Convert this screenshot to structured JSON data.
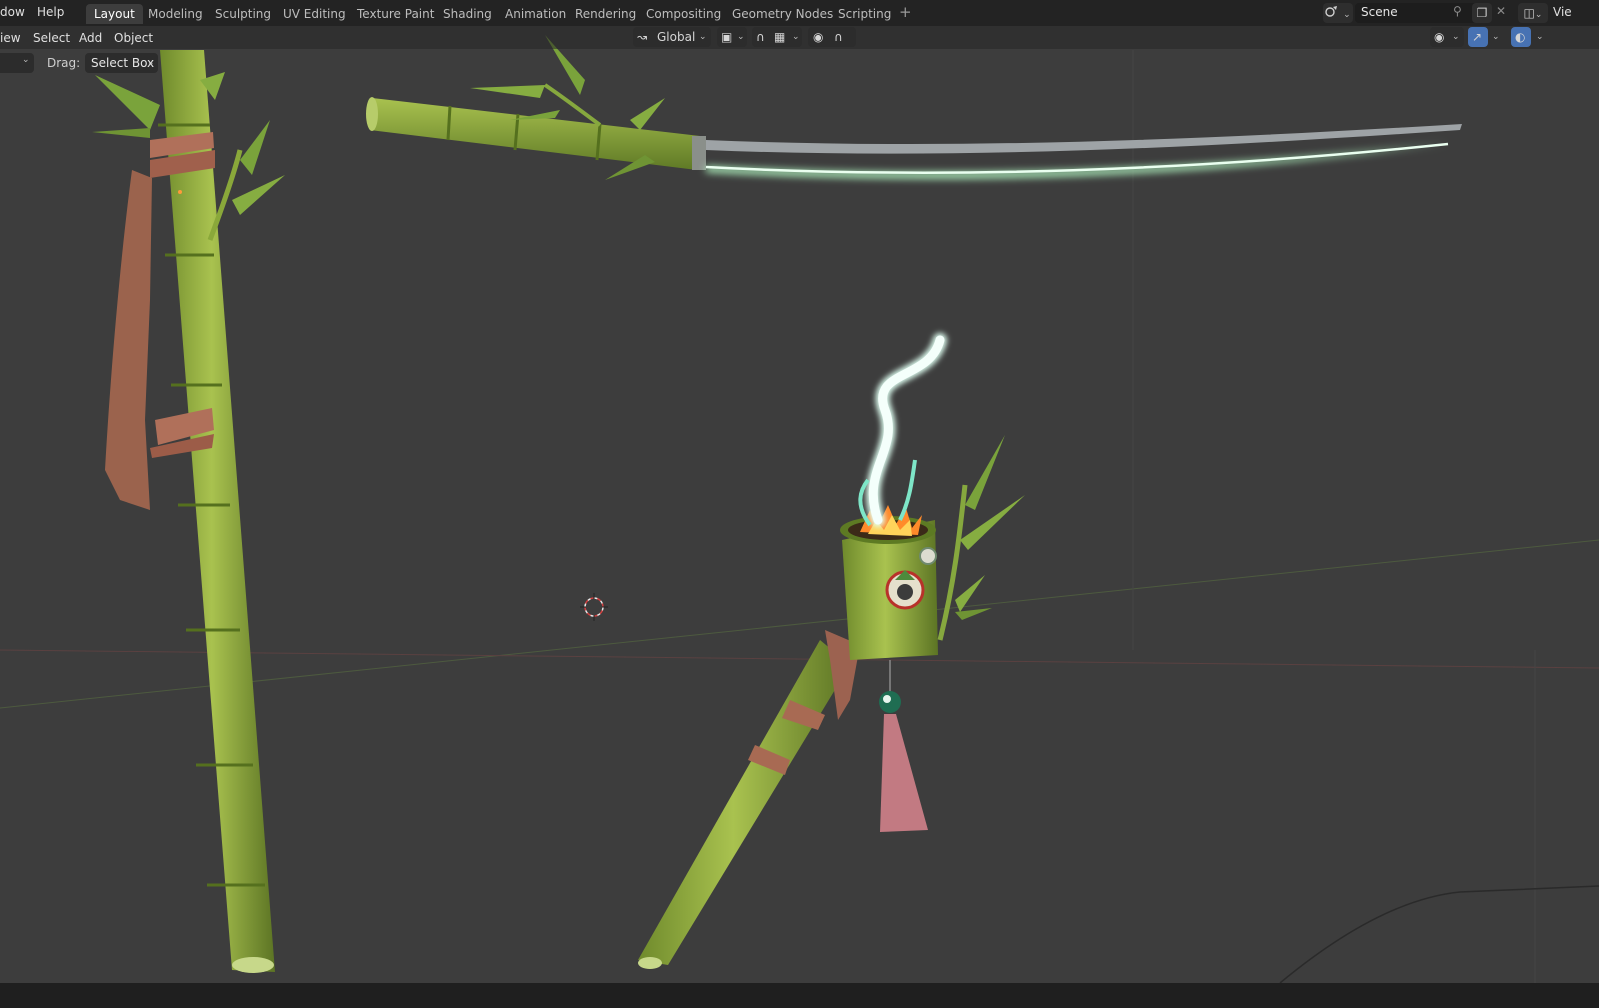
{
  "menubar": {
    "items": [
      "dow",
      "Help"
    ],
    "workspaces": [
      "Layout",
      "Modeling",
      "Sculpting",
      "UV Editing",
      "Texture Paint",
      "Shading",
      "Animation",
      "Rendering",
      "Compositing",
      "Geometry Nodes",
      "Scripting"
    ],
    "active_workspace": "Layout",
    "add_workspace": "+",
    "scene_label": "Scene",
    "view_layer_label": "Vie"
  },
  "header": {
    "menus": [
      "iew",
      "Select",
      "Add",
      "Object"
    ],
    "transform_orientation": "Global"
  },
  "tool_header": {
    "drag_label": "Drag:",
    "drag_value": "Select Box"
  },
  "icons": {
    "transform": "transform-orientation-icon",
    "pivot": "pivot-point-icon",
    "snap": "snap-magnet-icon",
    "snap_target": "snap-increment-icon",
    "proportional": "proportional-edit-icon",
    "falloff": "falloff-curve-icon",
    "visibility": "eye-visibility-icon",
    "gizmo": "gizmo-icon",
    "overlay": "overlay-icon",
    "scene": "scene-icon",
    "pin": "pin-icon",
    "new_scene": "new-scene-icon",
    "close": "close-icon",
    "view_layer": "view-layer-icon",
    "cursor": "3d-cursor-icon"
  },
  "colors": {
    "accent": "#4772b3",
    "viewport_bg": "#3d3d3d",
    "bamboo": "#8fae3e",
    "blade_glow": "#7dffa8",
    "rope": "#b0705a"
  }
}
